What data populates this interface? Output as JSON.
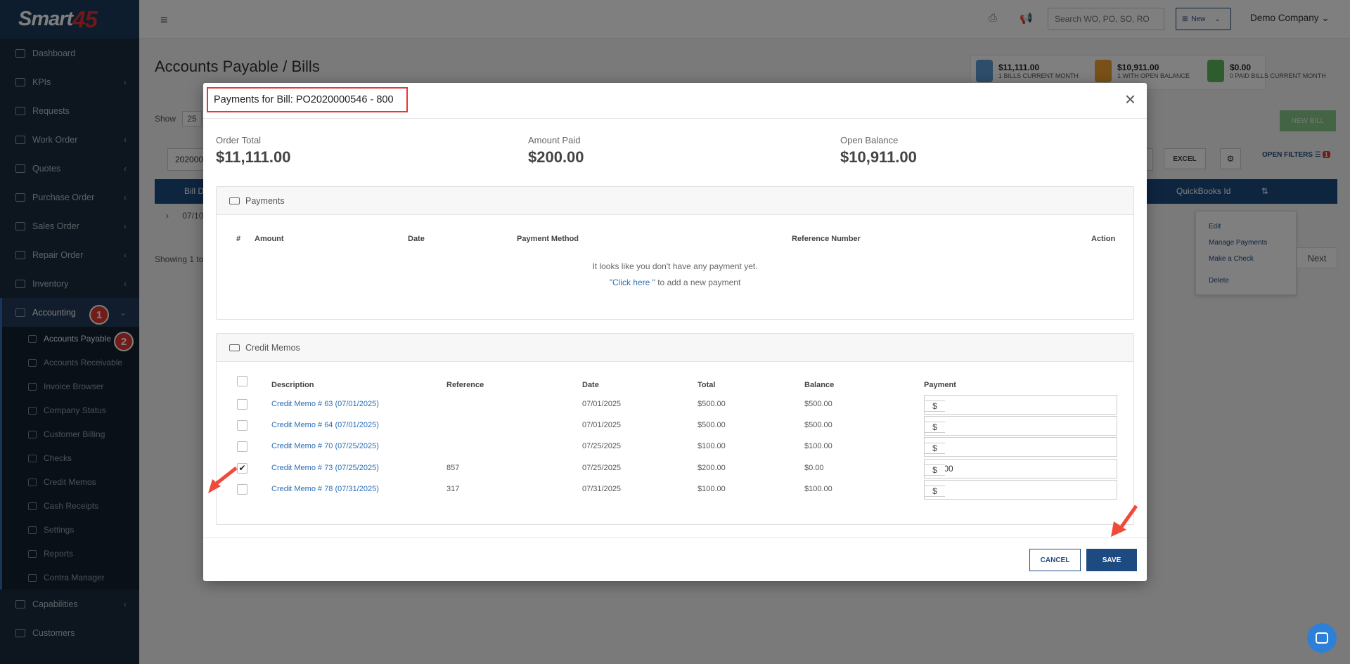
{
  "app": {
    "logo_text": "Smart",
    "logo_num": "45"
  },
  "sidebar": {
    "items": [
      {
        "label": "Dashboard",
        "chev": ""
      },
      {
        "label": "KPIs",
        "chev": "‹"
      },
      {
        "label": "Requests",
        "chev": ""
      },
      {
        "label": "Work Order",
        "chev": "‹"
      },
      {
        "label": "Quotes",
        "chev": "‹"
      },
      {
        "label": "Purchase Order",
        "chev": "‹"
      },
      {
        "label": "Sales Order",
        "chev": "‹"
      },
      {
        "label": "Repair Order",
        "chev": "‹"
      },
      {
        "label": "Inventory",
        "chev": "‹"
      },
      {
        "label": "Accounting",
        "chev": "⌄"
      }
    ],
    "subitems": [
      {
        "label": "Accounts Payable"
      },
      {
        "label": "Accounts Receivable"
      },
      {
        "label": "Invoice Browser"
      },
      {
        "label": "Company Status"
      },
      {
        "label": "Customer Billing"
      },
      {
        "label": "Checks"
      },
      {
        "label": "Credit Memos"
      },
      {
        "label": "Cash Receipts"
      },
      {
        "label": "Settings"
      },
      {
        "label": "Reports"
      },
      {
        "label": "Contra Manager"
      }
    ],
    "after": [
      {
        "label": "Capabilities",
        "chev": "‹"
      },
      {
        "label": "Customers",
        "chev": ""
      }
    ],
    "badge1": "1",
    "badge2": "2"
  },
  "topbar": {
    "menu_icon": "≡",
    "search_placeholder": "Search WO, PO, SO, RO",
    "new_label": "New",
    "company": "Demo Company"
  },
  "page": {
    "title": "Accounts Payable / Bills",
    "show_label": "Show",
    "show_value": "25",
    "filter_value": "202000",
    "excel_label": "EXCEL",
    "open_filters": "OPEN FILTERS",
    "filters_count": "1",
    "new_bill": "NEW BILL",
    "col_bill": "Bill D",
    "col_qb": "QuickBooks Id",
    "row_date": "07/10",
    "showing": "Showing 1 to",
    "next": "Next",
    "ctx": [
      "Edit",
      "Manage Payments",
      "Make a Check",
      "Delete"
    ],
    "stats": [
      {
        "value": "$11,111.00",
        "label": "1 BILLS CURRENT MONTH",
        "color": "#5b9bd5"
      },
      {
        "value": "$10,911.00",
        "label": "1 WITH OPEN BALANCE",
        "color": "#f0a030"
      },
      {
        "value": "$0.00",
        "label": "0 PAID BILLS CURRENT MONTH",
        "color": "#5cb85c"
      }
    ]
  },
  "modal": {
    "title": "Payments for Bill: PO2020000546 - 800",
    "close": "×",
    "order_total_label": "Order Total",
    "order_total": "$11,111.00",
    "amount_paid_label": "Amount Paid",
    "amount_paid": "$200.00",
    "open_balance_label": "Open Balance",
    "open_balance": "$10,911.00",
    "payments": {
      "title": "Payments",
      "headers": [
        "#",
        "Amount",
        "Date",
        "Payment Method",
        "Reference Number",
        "Action"
      ],
      "empty": "It looks like you don't have any payment yet.",
      "click_here": "\"Click here \"",
      "empty_suffix": " to add a new payment"
    },
    "credit_memos": {
      "title": "Credit Memos",
      "headers": [
        "Description",
        "Reference",
        "Date",
        "Total",
        "Balance",
        "Payment"
      ],
      "rows": [
        {
          "desc": "Credit Memo # 63 (07/01/2025)",
          "ref": "",
          "date": "07/01/2025",
          "total": "$500.00",
          "balance": "$500.00",
          "payment": "",
          "checked": false
        },
        {
          "desc": "Credit Memo # 64 (07/01/2025)",
          "ref": "",
          "date": "07/01/2025",
          "total": "$500.00",
          "balance": "$500.00",
          "payment": "",
          "checked": false
        },
        {
          "desc": "Credit Memo # 70 (07/25/2025)",
          "ref": "",
          "date": "07/25/2025",
          "total": "$100.00",
          "balance": "$100.00",
          "payment": "",
          "checked": false
        },
        {
          "desc": "Credit Memo # 73 (07/25/2025)",
          "ref": "857",
          "date": "07/25/2025",
          "total": "$200.00",
          "balance": "$0.00",
          "payment": "200.00",
          "checked": true
        },
        {
          "desc": "Credit Memo # 78 (07/31/2025)",
          "ref": "317",
          "date": "07/31/2025",
          "total": "$100.00",
          "balance": "$100.00",
          "payment": "",
          "checked": false
        }
      ],
      "currency": "$"
    },
    "cancel": "CANCEL",
    "save": "SAVE"
  },
  "colors": {
    "accent": "#1d4a80",
    "highlight": "#e53935",
    "link": "#2a6eb5"
  }
}
